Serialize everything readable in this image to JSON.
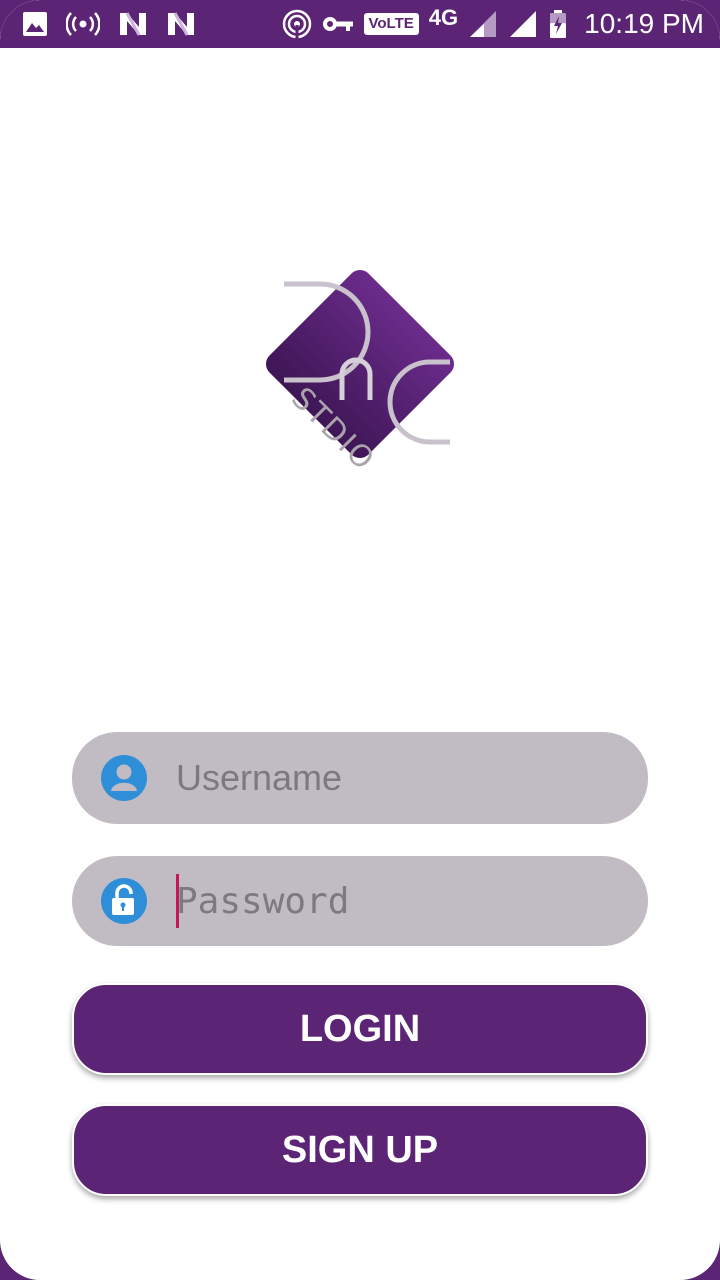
{
  "status_bar": {
    "time": "10:19 PM",
    "network": "4G",
    "volte": "VoLTE",
    "icons": [
      "image-icon",
      "hotspot-icon",
      "n-icon",
      "n-icon",
      "wifi-hotspot-icon",
      "key-icon",
      "volte-icon",
      "signal-icon",
      "signal-icon",
      "battery-charging-icon"
    ]
  },
  "logo": {
    "brand": "DnC",
    "subtitle": "STDIO"
  },
  "form": {
    "username_placeholder": "Username",
    "password_placeholder": "Password"
  },
  "buttons": {
    "login": "LOGIN",
    "signup": "SIGN UP"
  },
  "colors": {
    "primary": "#5b2474",
    "field_bg": "#c1bbc3",
    "icon_blue": "#2e8fd8",
    "caret": "#c2185b"
  }
}
